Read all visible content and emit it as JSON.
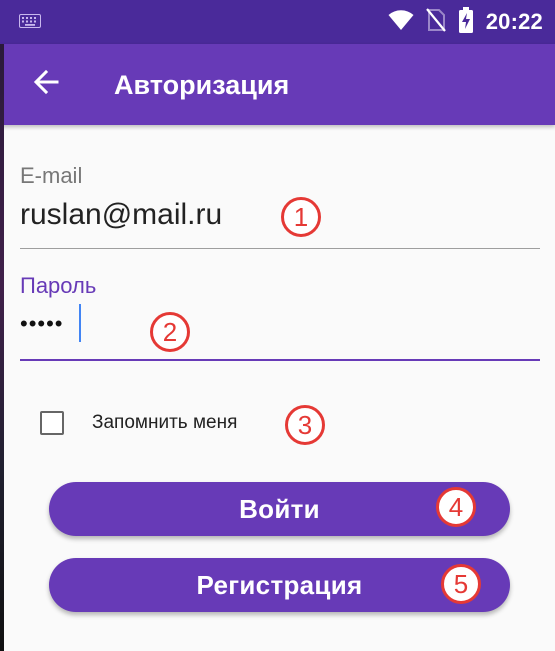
{
  "status_bar": {
    "time": "20:22",
    "icons": [
      "keyboard-icon",
      "wifi-icon",
      "no-sim-icon",
      "battery-charging-icon"
    ]
  },
  "app_bar": {
    "back_icon": "arrow-back-icon",
    "title": "Авторизация"
  },
  "form": {
    "email": {
      "label": "E-mail",
      "value": "ruslan@mail.ru"
    },
    "password": {
      "label": "Пароль",
      "value": "•••••"
    },
    "remember_me": {
      "label": "Запомнить меня",
      "checked": false
    },
    "login_button": "Войти",
    "register_button": "Регистрация"
  },
  "markers": [
    "1",
    "2",
    "3",
    "4",
    "5"
  ],
  "colors": {
    "status_bar": "#4a2a9a",
    "primary": "#673ab7",
    "accent_caret": "#4285f4",
    "marker": "#e53935"
  }
}
